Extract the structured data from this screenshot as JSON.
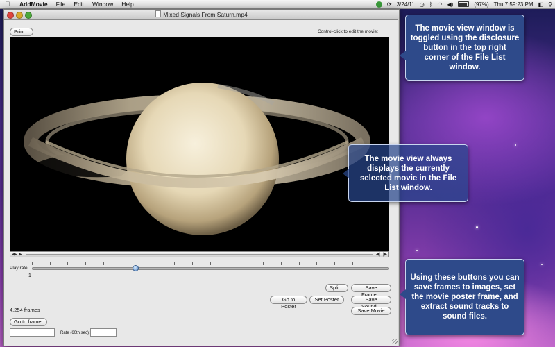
{
  "menubar": {
    "apple": "",
    "app_name": "AddMovie",
    "menus": [
      "File",
      "Edit",
      "Window",
      "Help"
    ],
    "date": "3/24/11",
    "battery": "(97%)",
    "time": "Thu 7:59:23 PM",
    "icons": [
      "app-status-icon",
      "sync-icon",
      "clock-icon",
      "bluetooth-icon",
      "wifi-icon",
      "volume-icon",
      "battery-icon",
      "user-icon",
      "spotlight-icon"
    ]
  },
  "window": {
    "title": "Mixed Signals From Saturn.mp4",
    "print_label": "Print...",
    "hint": "Control-click to edit the movie:",
    "play_rate_label": "Play rate:",
    "play_rate_value": "1",
    "play_rate_fraction": 0.29,
    "frame_count": "4,254 frames",
    "buttons": {
      "split": "Split...",
      "save_frame": "Save Frame...",
      "go_to_poster": "Go to Poster",
      "set_poster": "Set Poster",
      "save_sound": "Save Sound...",
      "save_movie": "Save Movie",
      "go_to_frame": "Go to frame:"
    },
    "rate_label": "Rate (60th sec):",
    "frame_value": "",
    "rate_value": ""
  },
  "callouts": {
    "toggle": "The movie view window is toggled using the disclosure button in the top right corner of the File List window.",
    "movie_view": "The movie view always displays the currently selected movie in the File List window.",
    "buttons": "Using these buttons you can save frames to images, set the movie poster frame, and extract sound tracks to sound files."
  },
  "colors": {
    "callout_bg": "#2e4a8a",
    "slider_knob": "#4f84c4",
    "window_bg": "#e8e8e8"
  }
}
